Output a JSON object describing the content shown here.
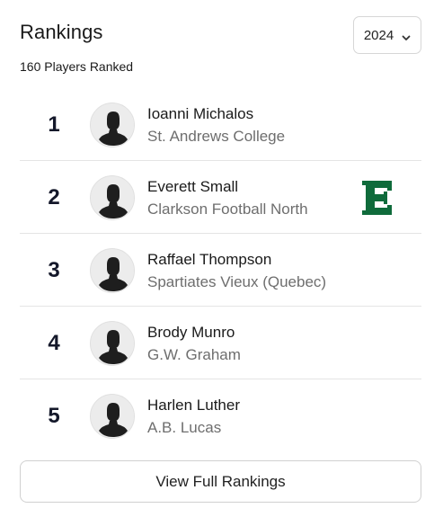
{
  "header": {
    "title": "Rankings",
    "subtitle": "160 Players Ranked",
    "year_select": {
      "value": "2024",
      "icon": "chevron-down-icon"
    }
  },
  "players": [
    {
      "rank": "1",
      "name": "Ioanni Michalos",
      "school": "St. Andrews College",
      "avatar": "avatar-placeholder-icon"
    },
    {
      "rank": "2",
      "name": "Everett Small",
      "school": "Clarkson Football North",
      "avatar": "avatar-placeholder-icon",
      "logo": {
        "icon": "e-logo-icon",
        "letter": "E",
        "color": "#0f6b3b"
      }
    },
    {
      "rank": "3",
      "name": "Raffael Thompson",
      "school": "Spartiates Vieux (Quebec)",
      "avatar": "avatar-placeholder-icon"
    },
    {
      "rank": "4",
      "name": "Brody Munro",
      "school": "G.W. Graham",
      "avatar": "avatar-placeholder-icon"
    },
    {
      "rank": "5",
      "name": "Harlen Luther",
      "school": "A.B. Lucas",
      "avatar": "avatar-placeholder-icon"
    }
  ],
  "footer": {
    "button_label": "View Full Rankings"
  },
  "colors": {
    "rank_text": "#14182a",
    "muted_text": "#6e6e6e",
    "divider": "#e4e4e4",
    "logo_green": "#0f6b3b"
  }
}
